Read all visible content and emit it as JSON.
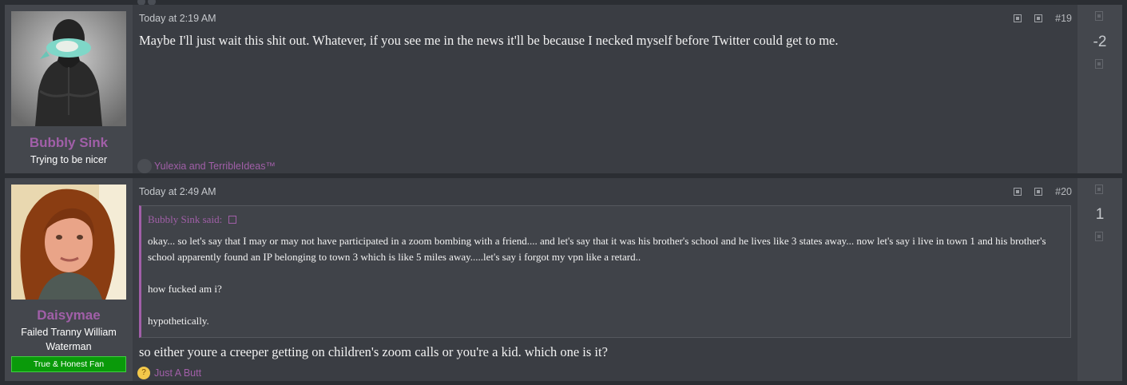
{
  "posts": [
    {
      "user": {
        "name": "Bubbly Sink",
        "title": "Trying to be nicer"
      },
      "date": "Today at 2:19 AM",
      "number": "#19",
      "body": "Maybe I'll just wait this shit out. Whatever, if you see me in the news it'll be because I necked myself before Twitter could get to me.",
      "reactions": "Yulexia and TerribleIdeas™",
      "score": "-2"
    },
    {
      "user": {
        "name": "Daisymae",
        "title": "Failed Tranny William Waterman",
        "banner": "True & Honest Fan"
      },
      "date": "Today at 2:49 AM",
      "number": "#20",
      "quote": {
        "author": "Bubbly Sink said:",
        "paragraphs": [
          "okay... so let's say that I may or may not have participated in a zoom bombing with a friend.... and let's say that it was his brother's school and he lives like 3 states away... now let's say i live in town 1 and his brother's school apparently found an IP belonging to town 3 which is like 5 miles away.....let's say i forgot my vpn like a retard..",
          "how fucked am i?",
          "hypothetically."
        ]
      },
      "body": "so either youre a creeper getting on children's zoom calls or you're a kid. which one is it?",
      "reactions": "Just A Butt",
      "score": "1"
    }
  ],
  "colors": {
    "accent": "#a15fa8",
    "banner_green": "#0a9a0a",
    "background": "#2b2e33",
    "panel": "#3a3d43",
    "sidebar": "#44474d"
  },
  "icons": [
    "bookmark-icon",
    "share-icon",
    "upvote-icon",
    "downvote-icon",
    "reaction-avatar-icon",
    "thinking-emoji-icon",
    "quote-expand-icon"
  ]
}
